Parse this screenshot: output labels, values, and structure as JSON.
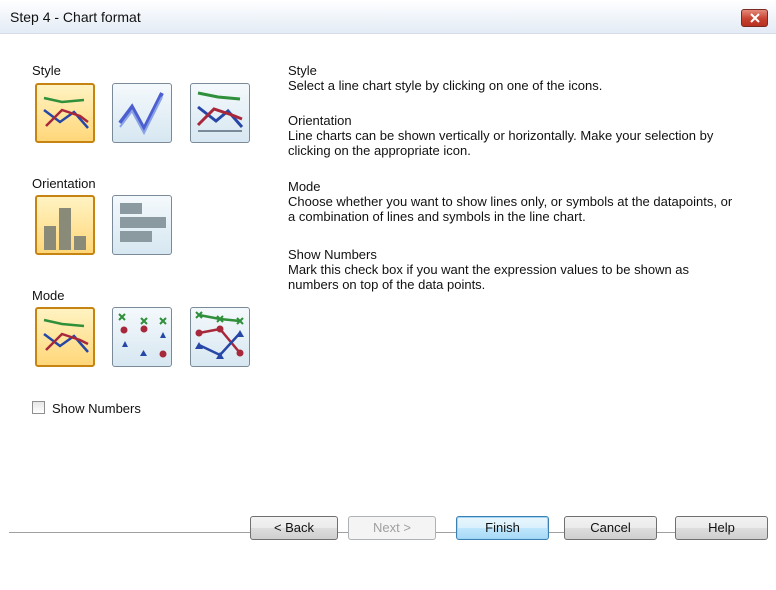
{
  "window": {
    "title": "Step 4 - Chart format"
  },
  "left": {
    "style_label": "Style",
    "orientation_label": "Orientation",
    "mode_label": "Mode",
    "show_numbers_label": "Show Numbers",
    "show_numbers_checked": false,
    "style_icons": [
      "line-style-1-icon",
      "line-style-2-icon",
      "line-style-3-icon"
    ],
    "orientation_icons": [
      "vertical-bars-icon",
      "horizontal-bars-icon"
    ],
    "mode_icons": [
      "lines-only-icon",
      "symbols-only-icon",
      "lines-and-symbols-icon"
    ]
  },
  "help": {
    "style_heading": "Style",
    "style_text": "Select a line chart style by clicking on one of the icons.",
    "orientation_heading": "Orientation",
    "orientation_text_1": "Line charts can be shown vertically or horizontally. Make your selection by",
    "orientation_text_2": "clicking on the appropriate icon.",
    "mode_heading": "Mode",
    "mode_text_1": "Choose whether you want to show lines only, or symbols at the datapoints, or",
    "mode_text_2": "a combination of lines and symbols in the line chart.",
    "numbers_heading": "Show Numbers",
    "numbers_text_1": "Mark this check box if you want the expression values to be shown as",
    "numbers_text_2": "numbers on top of the data points."
  },
  "buttons": {
    "back": "< Back",
    "next": "Next >",
    "finish": "Finish",
    "cancel": "Cancel",
    "help": "Help"
  },
  "colors": {
    "selected_border": "#c68412",
    "selected_fill": "#ffd77a",
    "default_button": "#3c7fb1"
  }
}
